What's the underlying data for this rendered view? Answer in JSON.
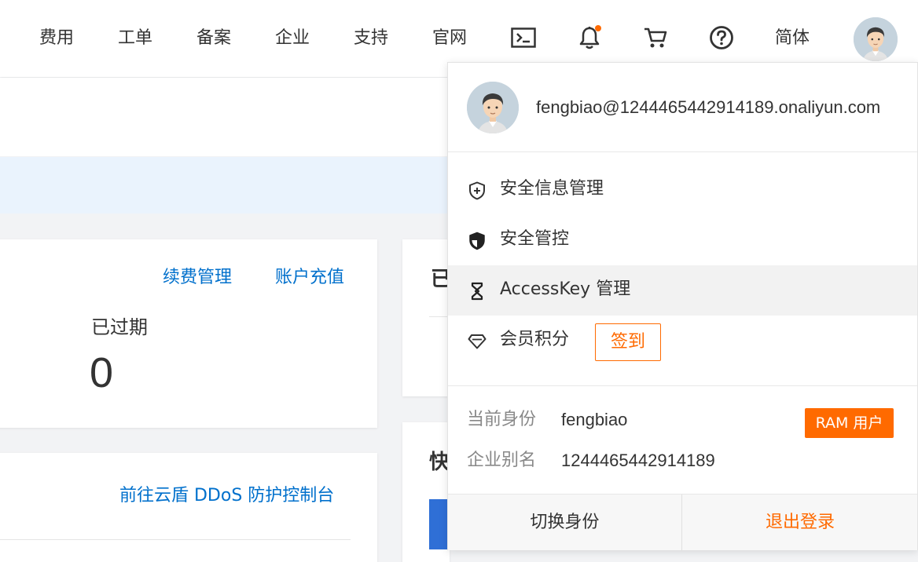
{
  "topnav": {
    "items": [
      "费用",
      "工单",
      "备案",
      "企业",
      "支持",
      "官网"
    ],
    "language": "简体",
    "icons": [
      "terminal-icon",
      "bell-icon",
      "cart-icon",
      "help-icon"
    ],
    "accent_color": "#ff6a00"
  },
  "background": {
    "card1": {
      "links": [
        "续费管理",
        "账户充值"
      ],
      "label": "已过期",
      "value": "0"
    },
    "card2": {
      "title_fragment": "已"
    },
    "card3": {
      "link": "前往云盾 DDoS 防护控制台"
    },
    "card4": {
      "title_fragment": "快"
    },
    "link_color": "#0070cc"
  },
  "user_menu": {
    "email": "fengbiao@1244465442914189.onaliyun.com",
    "items": [
      {
        "label": "安全信息管理",
        "icon": "shield-plus-icon"
      },
      {
        "label": "安全管控",
        "icon": "shield-filled-icon"
      },
      {
        "label": "AccessKey 管理",
        "icon": "accesskey-icon"
      },
      {
        "label": "会员积分",
        "icon": "diamond-icon"
      }
    ],
    "checkin_label": "签到",
    "identity": {
      "current_label": "当前身份",
      "current_value": "fengbiao",
      "badge": "RAM 用户",
      "alias_label": "企业别名",
      "alias_value": "1244465442914189"
    },
    "switch_label": "切换身份",
    "logout_label": "退出登录"
  }
}
